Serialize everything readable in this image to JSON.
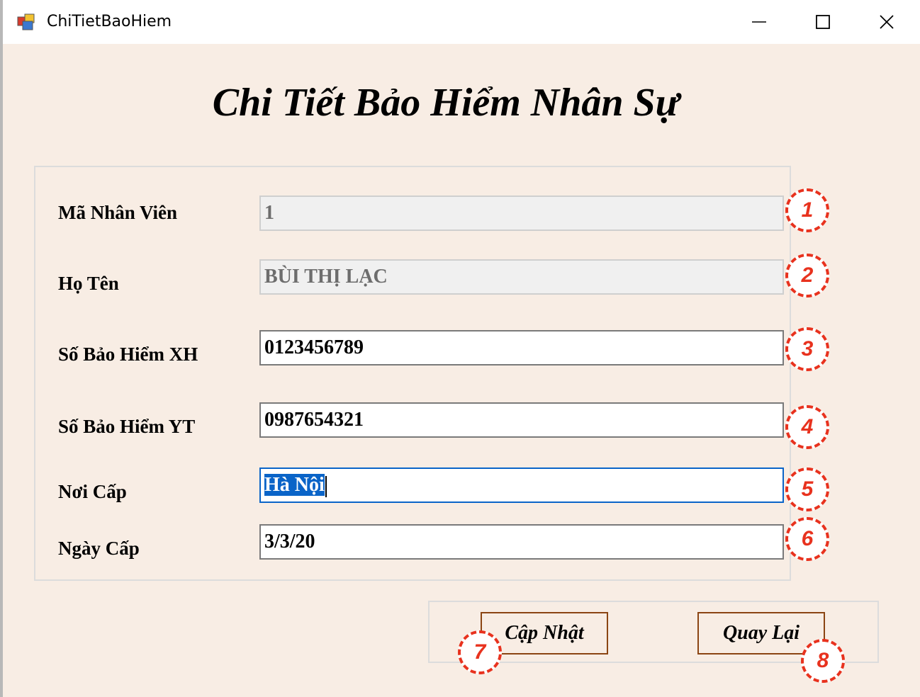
{
  "window": {
    "title": "ChiTietBaoHiem",
    "icons": [
      "app-icon",
      "minimize-icon",
      "maximize-icon",
      "close-icon"
    ]
  },
  "form": {
    "heading": "Chi Tiết Bảo Hiểm Nhân Sự",
    "fields": [
      {
        "label": "Mã Nhân Viên",
        "value": "1",
        "enabled": false
      },
      {
        "label": "Họ Tên",
        "value": "BÙI THỊ LẠC",
        "enabled": false
      },
      {
        "label": "Số Bảo Hiểm XH",
        "value": "0123456789",
        "enabled": true
      },
      {
        "label": "Số Bảo Hiểm YT",
        "value": "0987654321",
        "enabled": true
      },
      {
        "label": "Nơi Cấp",
        "value": "Hà Nội",
        "enabled": true,
        "focused": true,
        "selected": true
      },
      {
        "label": "Ngày Cấp",
        "value": "3/3/20",
        "enabled": true
      }
    ]
  },
  "buttons": {
    "update": "Cập Nhật",
    "back": "Quay Lại"
  },
  "markers": [
    "1",
    "2",
    "3",
    "4",
    "5",
    "6",
    "7",
    "8"
  ],
  "colors": {
    "background": "#f8ede4",
    "marker": "#e8321e",
    "button_border": "#8b4513",
    "selection": "#0a64c8"
  }
}
